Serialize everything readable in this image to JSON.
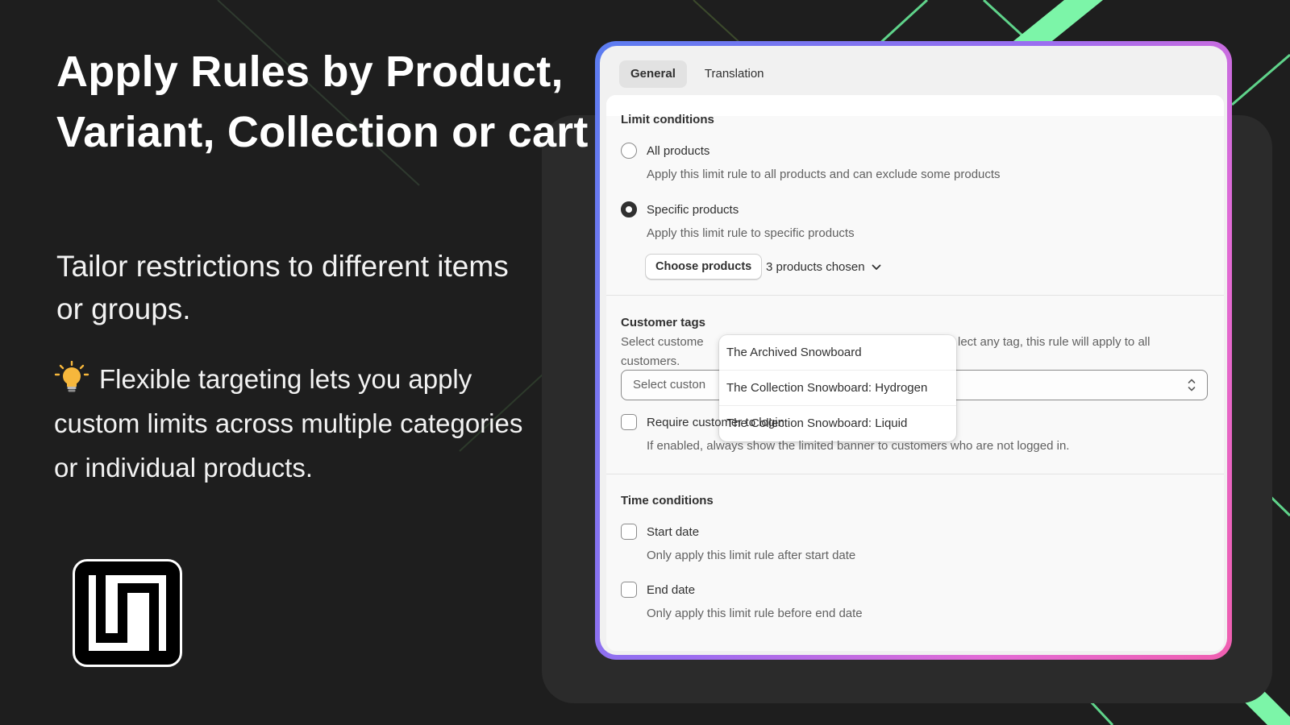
{
  "hero": {
    "headline": "Apply Rules by Product, Variant, Collection or cart",
    "subhead": "Tailor restrictions to different items or groups.",
    "tip_text": "Flexible targeting lets you apply custom limits across multiple categories or individual products.",
    "tip_icon": "lightbulb-icon"
  },
  "colors": {
    "background": "#1e1e1e",
    "accent_green": "#7cf5a8",
    "frame_gradient_start": "#5b7cf0",
    "frame_gradient_end": "#f05fb0"
  },
  "tabs": [
    {
      "label": "General",
      "active": true
    },
    {
      "label": "Translation",
      "active": false
    }
  ],
  "limit_conditions": {
    "title": "Limit conditions",
    "all_products": {
      "label": "All products",
      "help": "Apply this limit rule to all products and can exclude some products",
      "checked": false
    },
    "specific_products": {
      "label": "Specific products",
      "help": "Apply this limit rule to specific products",
      "checked": true
    },
    "choose_button": "Choose products",
    "chosen_summary": "3 products chosen",
    "chosen_items": [
      "The Archived Snowboard",
      "The Collection Snowboard: Hydrogen",
      "The Collection Snowboard: Liquid"
    ]
  },
  "customer_tags": {
    "title": "Customer tags",
    "help_visible_left": "Select custome",
    "help_visible_right": "lect any tag, this rule will apply to all",
    "help_line2": "customers.",
    "select_placeholder": "Select custon"
  },
  "require_login": {
    "label": "Require customer to login",
    "help": "If enabled, always show the limited banner to customers who are not logged in.",
    "checked": false
  },
  "time_conditions": {
    "title": "Time conditions",
    "start_date": {
      "label": "Start date",
      "help": "Only apply this limit rule after start date",
      "checked": false
    },
    "end_date": {
      "label": "End date",
      "help": "Only apply this limit rule before end date",
      "checked": false
    }
  }
}
